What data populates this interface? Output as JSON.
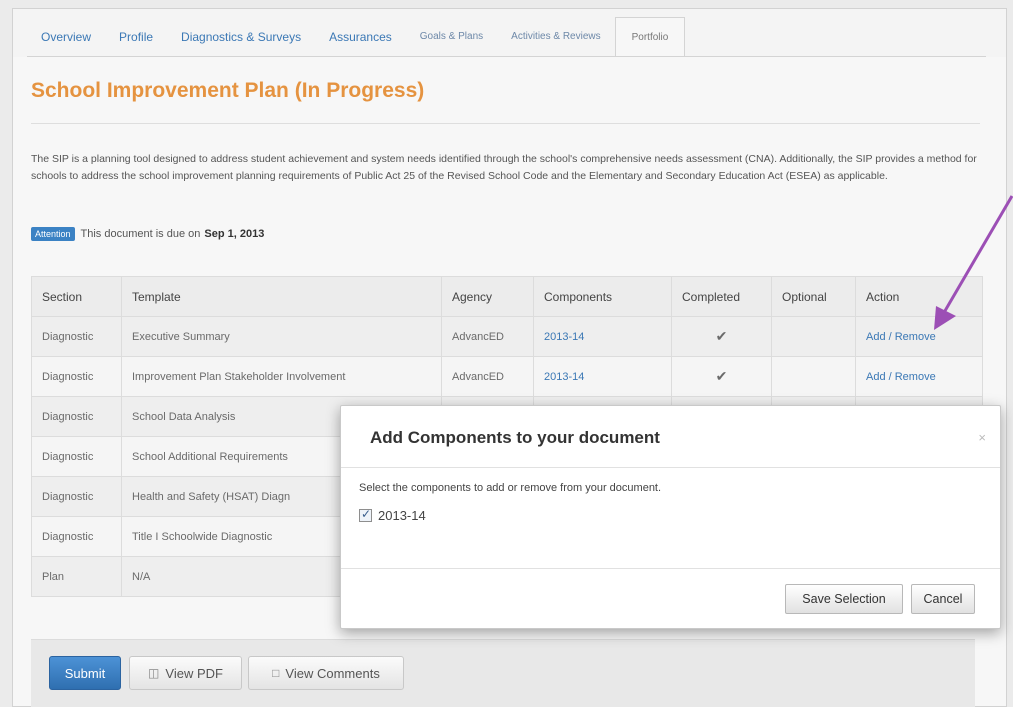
{
  "tabs": [
    {
      "label": "Overview"
    },
    {
      "label": "Profile"
    },
    {
      "label": "Diagnostics & Surveys"
    },
    {
      "label": "Assurances"
    },
    {
      "label": "Goals & Plans"
    },
    {
      "label": "Activities & Reviews"
    },
    {
      "label": "Portfolio"
    }
  ],
  "page": {
    "title": "School Improvement Plan (In Progress)",
    "description": "The SIP is a planning tool designed to address student achievement and system needs identified through the school's comprehensive needs assessment (CNA). Additionally, the SIP provides a method for schools to address the school improvement planning requirements of Public Act 25 of the Revised School Code and the Elementary and Secondary Education Act (ESEA) as applicable.",
    "attention_badge": "Attention",
    "due_text": "This document is due on",
    "due_date": "Sep 1, 2013"
  },
  "table": {
    "headers": {
      "section": "Section",
      "template": "Template",
      "agency": "Agency",
      "components": "Components",
      "completed": "Completed",
      "optional": "Optional",
      "action": "Action"
    },
    "rows": [
      {
        "section": "Diagnostic",
        "template": "Executive Summary",
        "agency": "AdvancED",
        "components": "2013-14",
        "completed": "✔",
        "action": "Add / Remove"
      },
      {
        "section": "Diagnostic",
        "template": "Improvement Plan Stakeholder Involvement",
        "agency": "AdvancED",
        "components": "2013-14",
        "completed": "✔",
        "action": "Add / Remove"
      },
      {
        "section": "Diagnostic",
        "template": "School Data Analysis"
      },
      {
        "section": "Diagnostic",
        "template": "School Additional Requirements"
      },
      {
        "section": "Diagnostic",
        "template": "Health and Safety (HSAT) Diagn"
      },
      {
        "section": "Diagnostic",
        "template": "Title I Schoolwide Diagnostic"
      },
      {
        "section": "Plan",
        "template": "N/A"
      }
    ]
  },
  "buttons": {
    "submit": "Submit",
    "view_pdf": "View PDF",
    "view_comments": "View Comments"
  },
  "modal": {
    "title": "Add Components to your document",
    "close": "×",
    "instructions": "Select the components to add or remove from your document.",
    "option_label": "2013-14",
    "option_checked": true,
    "save_label": "Save Selection",
    "cancel_label": "Cancel"
  },
  "colors": {
    "title_orange": "#e59340",
    "link_blue": "#3b78b5",
    "check_green": "#5cb85c",
    "arrow_purple": "#9c4fb5"
  }
}
